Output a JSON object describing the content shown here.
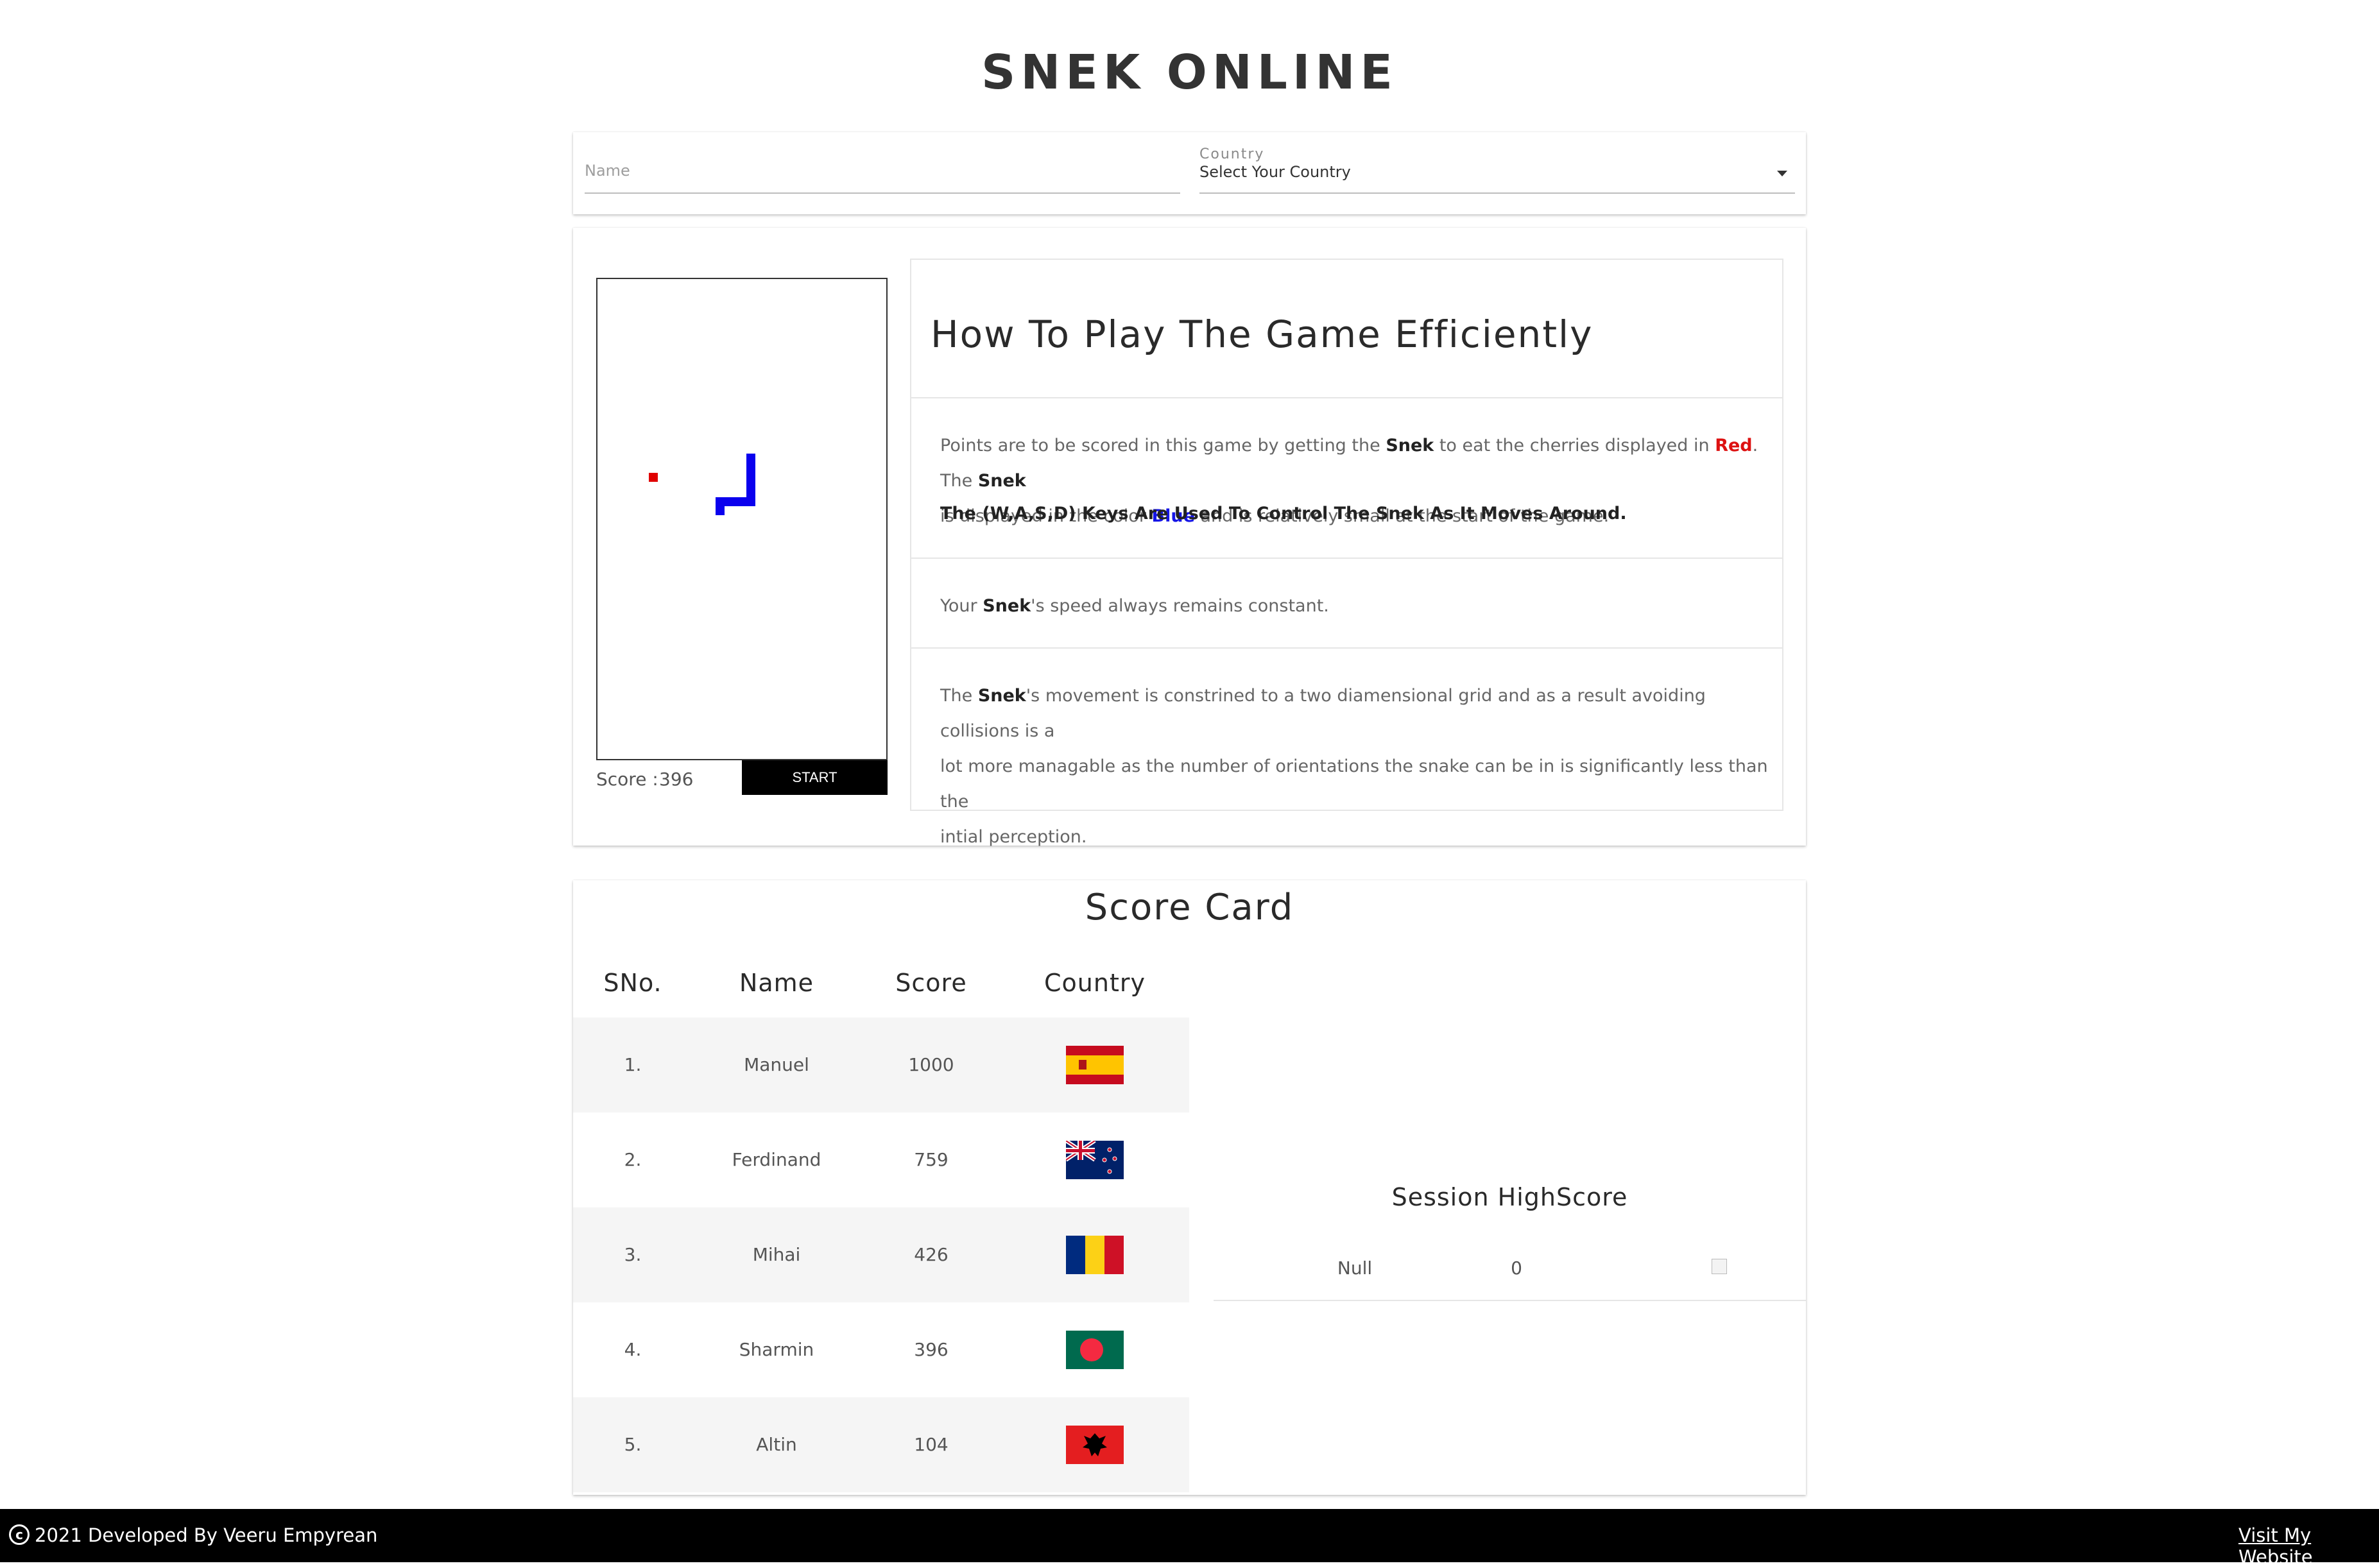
{
  "header": {
    "title": "SNEK ONLINE"
  },
  "form": {
    "name_placeholder": "Name",
    "country_label": "Country",
    "country_value": "Select Your Country"
  },
  "game": {
    "score_label": "Score :",
    "score_value": "396",
    "start_label": "START",
    "snake_color": "#0b00ee",
    "cherry_color": "#e00000"
  },
  "howto": {
    "title": "How To Play The Game Efficiently",
    "p1": {
      "t1": "Points are to be scored in this game by getting the ",
      "snek1": "Snek",
      "t2": " to eat the cherries displayed in ",
      "red": "Red",
      "t3": ". The ",
      "snek2": "Snek",
      "t4": "is displayed in the color ",
      "blue": "Blue",
      "t5": " and is relatively small at the start of the game."
    },
    "keys_line": "The (W,A,S,D) Keys Are Used To Control The Snek As It Moves Around.",
    "p2": {
      "t1": "Your ",
      "snek": "Snek",
      "t2": "'s speed always remains constant."
    },
    "p3": {
      "t1": "The ",
      "snek": "Snek",
      "t2": "'s movement is constrined to a two diamensional grid and as a result avoiding collisions is a",
      "line2": "lot more managable as the number of orientations the snake can be in is significantly less than the",
      "line3": "intial perception."
    }
  },
  "scorecard": {
    "title": "Score Card",
    "columns": [
      "SNo.",
      "Name",
      "Score",
      "Country"
    ],
    "rows": [
      {
        "sno": "1.",
        "name": "Manuel",
        "score": "1000",
        "flag": "spain-flag"
      },
      {
        "sno": "2.",
        "name": "Ferdinand",
        "score": "759",
        "flag": "new-zealand-flag"
      },
      {
        "sno": "3.",
        "name": "Mihai",
        "score": "426",
        "flag": "romania-flag"
      },
      {
        "sno": "4.",
        "name": "Sharmin",
        "score": "396",
        "flag": "bangladesh-flag"
      },
      {
        "sno": "5.",
        "name": "Altin",
        "score": "104",
        "flag": "albania-flag"
      }
    ]
  },
  "session": {
    "title": "Session HighScore",
    "name": "Null",
    "score": "0"
  },
  "footer": {
    "copyright_icon": "copyright-icon",
    "text": "2021 Developed By Veeru Empyrean",
    "link": "Visit My Website"
  }
}
